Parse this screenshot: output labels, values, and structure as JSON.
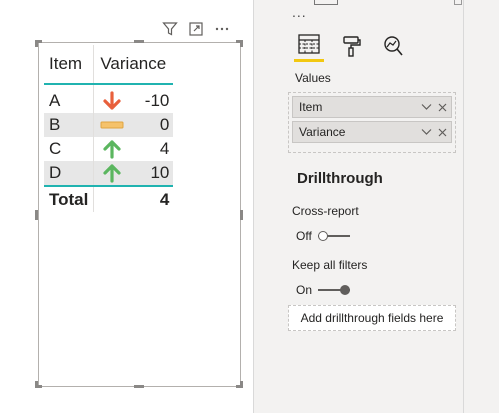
{
  "visual_header": {
    "icons": [
      "filter-icon",
      "focus-mode-icon",
      "more-options-icon"
    ]
  },
  "table": {
    "columns": [
      "Item",
      "Variance"
    ],
    "rows": [
      {
        "item": "A",
        "variance": "-10",
        "indicator": "down-arrow",
        "indicator_color": "#e8603c"
      },
      {
        "item": "B",
        "variance": "0",
        "indicator": "flat-bar",
        "indicator_color": "#f5c26b"
      },
      {
        "item": "C",
        "variance": "4",
        "indicator": "up-arrow",
        "indicator_color": "#5bb65f"
      },
      {
        "item": "D",
        "variance": "10",
        "indicator": "up-arrow",
        "indicator_color": "#5bb65f"
      }
    ],
    "total_label": "Total",
    "total_value": "4",
    "accent_color": "#20b3b0"
  },
  "pane": {
    "overflow_label": "...",
    "tabs": [
      {
        "name": "fields-tab",
        "icon": "table-grid-icon",
        "active": true
      },
      {
        "name": "format-tab",
        "icon": "paint-roller-icon",
        "active": false
      },
      {
        "name": "analytics-tab",
        "icon": "magnifier-chart-icon",
        "active": false
      }
    ],
    "values_label": "Values",
    "fields": [
      "Item",
      "Variance"
    ],
    "drillthrough": {
      "title": "Drillthrough",
      "cross_report_label": "Cross-report",
      "cross_report_state": "Off",
      "keep_filters_label": "Keep all filters",
      "keep_filters_state": "On",
      "add_fields_placeholder": "Add drillthrough fields here"
    },
    "active_tab_color": "#f2c811"
  }
}
